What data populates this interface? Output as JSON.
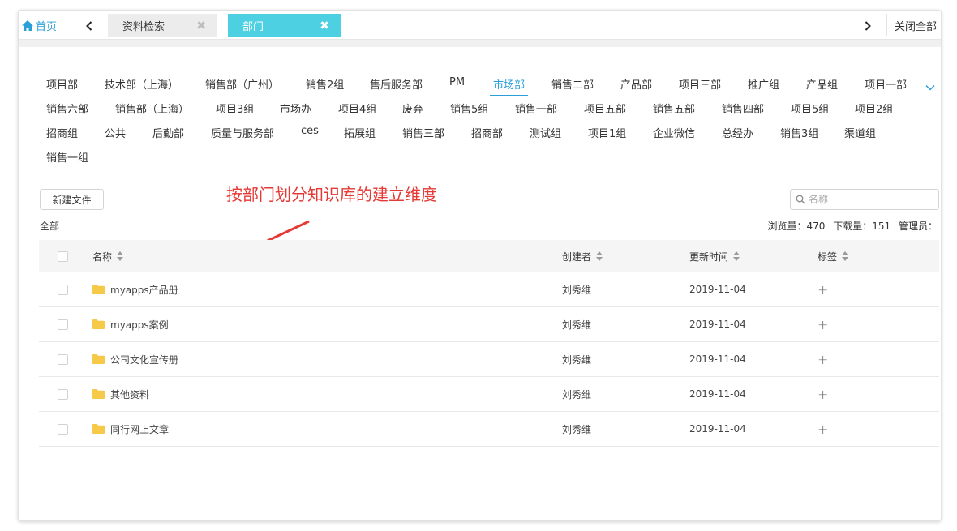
{
  "tabs": {
    "home_label": "首页",
    "items": [
      {
        "label": "资料检索",
        "close": "✖"
      },
      {
        "label": "部门",
        "close": "✖"
      }
    ],
    "close_all": "关闭全部"
  },
  "departments": {
    "rows": [
      [
        "项目部",
        "技术部（上海）",
        "销售部（广州）",
        "销售2组",
        "售后服务部",
        "PM",
        "市场部",
        "销售二部",
        "产品部",
        "项目三部",
        "推广组",
        "产品组",
        "项目一部"
      ],
      [
        "销售六部",
        "销售部（上海）",
        "项目3组",
        "市场办",
        "项目4组",
        "废弃",
        "销售5组",
        "销售一部",
        "项目五部",
        "销售五部",
        "销售四部",
        "项目5组",
        "项目2组"
      ],
      [
        "招商组",
        "公共",
        "后勤部",
        "质量与服务部",
        "ces",
        "拓展组",
        "销售三部",
        "招商部",
        "测试组",
        "项目1组",
        "企业微信",
        "总经办",
        "销售3组",
        "渠道组"
      ],
      [
        "销售一组"
      ]
    ],
    "active": "市场部"
  },
  "annotation": "按部门划分知识库的建立维度",
  "toolbar": {
    "new_file": "新建文件",
    "search_placeholder": "名称"
  },
  "breadcrumb": "全部",
  "stats": {
    "views": "浏览量：470",
    "downloads": "下载量：151",
    "admin": "管理员："
  },
  "table": {
    "headers": {
      "name": "名称",
      "creator": "创建者",
      "time": "更新时间",
      "tag": "标签"
    },
    "rows": [
      {
        "name": "myapps产品册",
        "creator": "刘秀维",
        "time": "2019-11-04",
        "tag": "+"
      },
      {
        "name": "myapps案例",
        "creator": "刘秀维",
        "time": "2019-11-04",
        "tag": "+"
      },
      {
        "name": "公司文化宣传册",
        "creator": "刘秀维",
        "time": "2019-11-04",
        "tag": "+"
      },
      {
        "name": "其他资料",
        "creator": "刘秀维",
        "time": "2019-11-04",
        "tag": "+"
      },
      {
        "name": "同行网上文章",
        "creator": "刘秀维",
        "time": "2019-11-04",
        "tag": "+"
      }
    ]
  },
  "colors": {
    "accent": "#2a9fd8",
    "active_tab": "#4dd0e1",
    "annotation": "#e53935",
    "folder": "#f7c948"
  }
}
